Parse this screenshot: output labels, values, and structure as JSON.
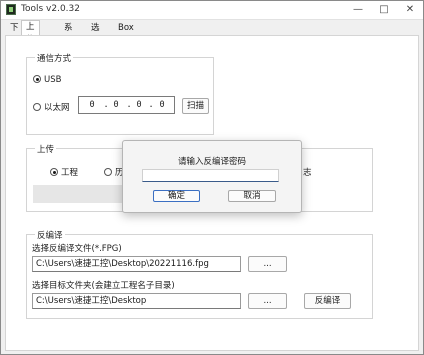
{
  "window": {
    "title": "Tools v2.0.32"
  },
  "titlebar_buttons": {
    "minimize": "—",
    "maximize": "□",
    "close": "✕"
  },
  "tabs": [
    {
      "label": "下载",
      "active": false
    },
    {
      "label": "上传",
      "active": true
    },
    {
      "label": "系统",
      "active": false
    },
    {
      "label": "选件",
      "active": false
    },
    {
      "label": "Box参数",
      "active": false
    }
  ],
  "comm": {
    "title": "通信方式",
    "usb_label": "USB",
    "usb_checked": true,
    "ethernet_label": "以太网",
    "ethernet_checked": false,
    "ip_octets": [
      "0",
      "0",
      "0",
      "0"
    ],
    "ip_separator": ".",
    "scan_button": "扫描"
  },
  "upload": {
    "title": "上传",
    "project_label": "工程",
    "project_checked": true,
    "history_label": "历",
    "history_checked": false,
    "trailing_fragment": "志"
  },
  "decompile": {
    "title": "反编译",
    "file_label": "选择反编译文件(*.FPG)",
    "file_value": "C:\\Users\\速捷工控\\Desktop\\20221116.fpg",
    "browse1_label": "...",
    "folder_label": "选择目标文件夹(会建立工程名子目录)",
    "folder_value": "C:\\Users\\速捷工控\\Desktop",
    "browse2_label": "...",
    "decompile_button": "反编译"
  },
  "dialog": {
    "prompt": "请输入反编译密码",
    "password_value": "",
    "ok_label": "确定",
    "cancel_label": "取消"
  }
}
